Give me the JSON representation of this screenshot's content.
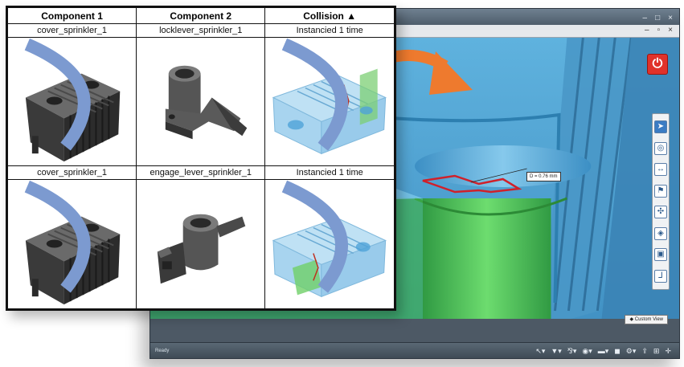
{
  "table": {
    "headers": {
      "component1": "Component 1",
      "component2": "Component 2",
      "collision": "Collision",
      "sort_indicator": "▲"
    },
    "rows": [
      {
        "component1": "cover_sprinkler_1",
        "component2": "locklever_sprinkler_1",
        "collision": "Instancied 1 time"
      },
      {
        "component1": "cover_sprinkler_1",
        "component2": "engage_lever_sprinkler_1",
        "collision": "Instancied 1 time"
      }
    ]
  },
  "viewer": {
    "dimension_label": "D = 0.76 mm",
    "custom_view_label": "Custom View",
    "status_text": "Ready",
    "colors": {
      "accent_arrow": "#ee7a2e",
      "collision_red": "#d0202a",
      "part_green": "#58d05a",
      "part_blue": "#6fb6e2",
      "power_red": "#e0322a"
    },
    "icons": {
      "power": "power-icon",
      "toolbar": [
        "select-icon",
        "section-icon",
        "measure-icon",
        "annotate-icon",
        "explode-icon",
        "view-icon",
        "fit-icon",
        "axis-icon"
      ],
      "statusbar": [
        "pointer-icon",
        "filter-icon",
        "tree-icon",
        "eye-icon",
        "camera-icon",
        "cube-icon",
        "settings-icon",
        "export-icon",
        "grid-icon",
        "pan-icon"
      ]
    }
  }
}
